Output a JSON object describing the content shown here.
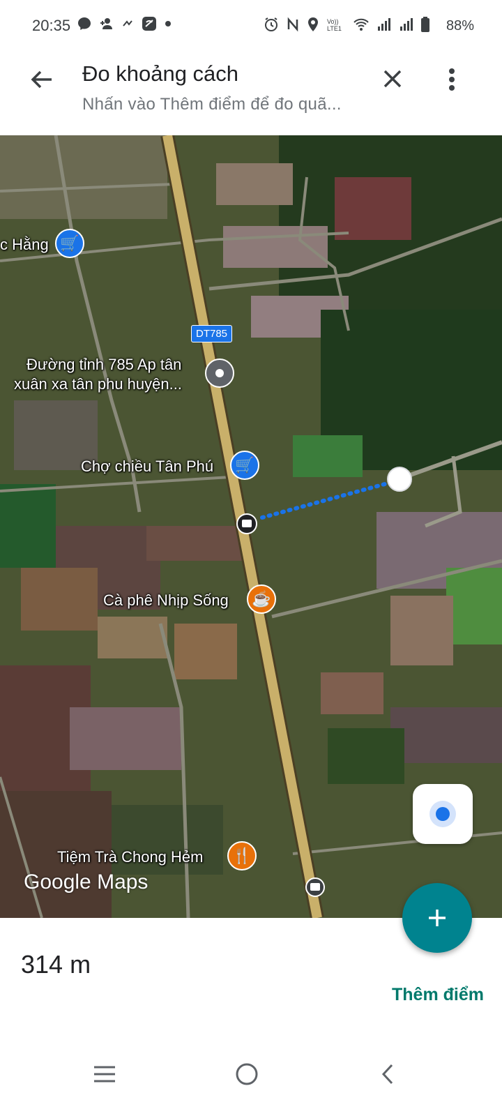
{
  "status_bar": {
    "time": "20:35",
    "battery": "88%",
    "left_icons": [
      "messenger-icon",
      "add-person-icon",
      "app-notification-icon",
      "vpn-icon",
      "dot-icon"
    ],
    "right_icons": [
      "alarm-icon",
      "nfc-icon",
      "location-icon",
      "volte-icon",
      "wifi-icon",
      "signal-icon",
      "signal-icon",
      "battery-icon"
    ]
  },
  "header": {
    "title": "Đo khoảng cách",
    "subtitle": "Nhấn vào Thêm điểm để đo quã..."
  },
  "map": {
    "road_shield": "DT785",
    "pois": [
      {
        "label": "c Hằng",
        "type": "shopping-cart-icon",
        "color": "#1a73e8"
      },
      {
        "label": "Đường tỉnh 785 Ap tân",
        "label2": "xuân xa tân phu huyện...",
        "type": "location-pin-icon",
        "color": "#5f6368"
      },
      {
        "label": "Chợ chiều Tân Phú",
        "type": "shopping-cart-icon",
        "color": "#1a73e8"
      },
      {
        "label": "Cà phê Nhịp Sống",
        "type": "coffee-icon",
        "color": "#e8710a"
      },
      {
        "label": "Tiệm Trà Chong Hẻm",
        "type": "restaurant-icon",
        "color": "#e8710a"
      }
    ],
    "logo": "Google Maps"
  },
  "bottom_sheet": {
    "distance": "314 m",
    "add_point_label": "Thêm điểm",
    "fab_symbol": "+"
  },
  "colors": {
    "accent": "#00838f",
    "link": "#00796b",
    "measure_line": "#1a73e8"
  }
}
